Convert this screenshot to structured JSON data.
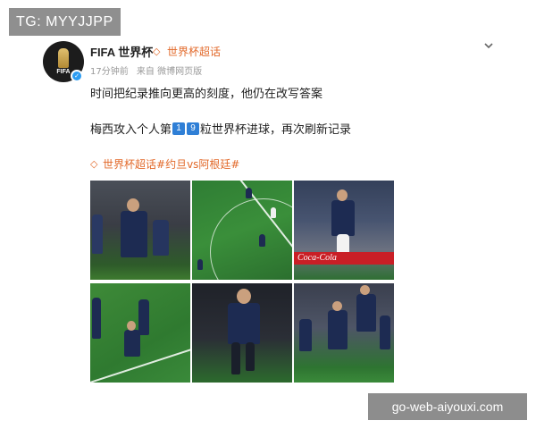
{
  "overlay": {
    "tg_label": "TG: MYYJJPP",
    "watermark": "go-web-aiyouxi.com"
  },
  "post": {
    "author": "FIFA 世界杯",
    "avatar_text": "FIFA",
    "topic_tag": "世界杯超话",
    "time": "17分钟前",
    "source": "来自 微博网页版",
    "line1": "时间把纪录推向更高的刻度，他仍在改写答案",
    "line2_prefix": "梅西攻入个人第",
    "num_a": "1",
    "num_b": "9",
    "line2_suffix": "粒世界杯进球，再次刷新记录",
    "hashtag_topic": "世界杯超话",
    "hashtag_match": "#约旦vs阿根廷#",
    "ad_text": "Coca-Cola"
  },
  "colors": {
    "accent": "#e2692a",
    "verified": "#2b9cf2",
    "number_badge": "#2f7fd6"
  },
  "icons": [
    "chevron-down-icon",
    "diamond-icon",
    "verified-icon"
  ]
}
